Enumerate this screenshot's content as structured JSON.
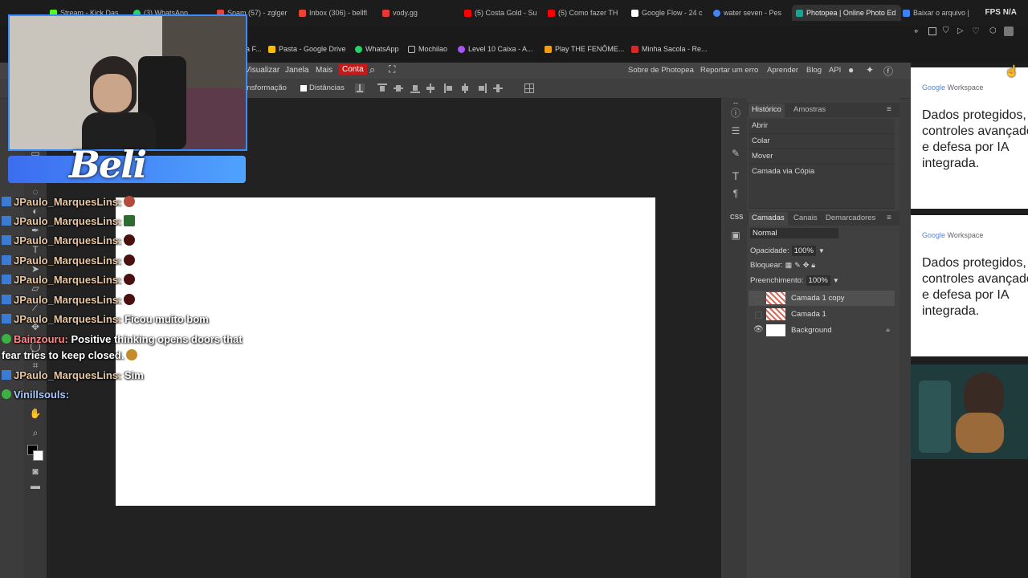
{
  "tabs": [
    {
      "label": "Stream - Kick Das",
      "color": "#53fc18"
    },
    {
      "label": "(3) WhatsApp",
      "color": "#25d366"
    },
    {
      "label": "Spam (57) - zglger",
      "color": "#ea4335"
    },
    {
      "label": "Inbox (306) - bellfl",
      "color": "#ea4335"
    },
    {
      "label": "vody.gg",
      "color": "#e53935"
    },
    {
      "label": "(5) Costa Gold - Su",
      "color": "#ff0000"
    },
    {
      "label": "(5) Como fazer TH",
      "color": "#ff0000"
    },
    {
      "label": "Google Flow - 24 c",
      "color": "#ffffff"
    },
    {
      "label": "water seven - Pes",
      "color": "#4285f4"
    },
    {
      "label": "Photopea | Online Photo Ed",
      "color": "#18a497"
    },
    {
      "label": "Baixar o arquivo |",
      "color": "#3b82f6"
    }
  ],
  "fps_label": "FPS",
  "fps_value": "N/A",
  "bookmarks": [
    {
      "label": "Pasta - Google Drive",
      "color": "#fbbc04"
    },
    {
      "label": "WhatsApp",
      "color": "#25d366"
    },
    {
      "label": "Mochilao",
      "color": "#bdbdbd"
    },
    {
      "label": "Level 10 Caixa - A...",
      "color": "#a855f7"
    },
    {
      "label": "Play THE FENÔME...",
      "color": "#f59e0b"
    },
    {
      "label": "Minha Sacola - Re...",
      "color": "#dc2626"
    }
  ],
  "bookmark_partial": "a F...",
  "menu": {
    "visualizar": "Visualizar",
    "janela": "Janela",
    "mais": "Mais",
    "conta": "Conta",
    "sobre": "Sobre de Photopea",
    "reportar": "Reportar um erro",
    "aprender": "Aprender",
    "blog": "Blog",
    "api": "API"
  },
  "options": {
    "transform": "ansformação",
    "distances": "Distâncias"
  },
  "history": {
    "tab_history": "Histórico",
    "tab_samples": "Amostras",
    "items": [
      "Abrir",
      "Colar",
      "Mover",
      "Camada via Cópia"
    ]
  },
  "layers": {
    "tab_layers": "Camadas",
    "tab_channels": "Canais",
    "tab_comps": "Demarcadores",
    "blend_mode": "Normal",
    "opacity_label": "Opacidade:",
    "opacity_value": "100%",
    "lock_label": "Bloquear:",
    "fill_label": "Preenchimento:",
    "fill_value": "100%",
    "items": [
      {
        "name": "Camada 1 copy"
      },
      {
        "name": "Camada 1"
      },
      {
        "name": "Background"
      }
    ]
  },
  "ads": [
    {
      "brand_google": "Google",
      "brand_rest": " Workspace",
      "copy": "Dados protegidos, controles avançados e defesa por IA integrada."
    },
    {
      "brand_google": "Google",
      "brand_rest": " Workspace",
      "copy": "Dados protegidos, controles avançados e defesa por IA integrada."
    }
  ],
  "overlay": {
    "logo": "Beli",
    "chat": [
      {
        "user": "JPaulo_MarquesLins:",
        "text": "",
        "emote": "#b34a3a"
      },
      {
        "user": "JPaulo_MarquesLins:",
        "text": "",
        "emote": "#2e6b2e"
      },
      {
        "user": "JPaulo_MarquesLins:",
        "text": "",
        "emote": "#4a1010"
      },
      {
        "user": "JPaulo_MarquesLins:",
        "text": "",
        "emote": "#4a1010"
      },
      {
        "user": "JPaulo_MarquesLins:",
        "text": "",
        "emote": "#4a1010"
      },
      {
        "user": "JPaulo_MarquesLins:",
        "text": "",
        "emote": "#4a1010"
      },
      {
        "user": "JPaulo_MarquesLins:",
        "text": "Ficou muito bom",
        "emote": ""
      },
      {
        "user": "Bainzouru:",
        "text": "Positive thinking opens doors that",
        "emote": ""
      },
      {
        "user": "",
        "text": "fear tries to keep closed.",
        "emote": "#c58b2a"
      },
      {
        "user": "JPaulo_MarquesLins:",
        "text": "Sim",
        "emote": ""
      },
      {
        "user": "Vinillsouls:",
        "text": "",
        "emote": ""
      }
    ]
  }
}
